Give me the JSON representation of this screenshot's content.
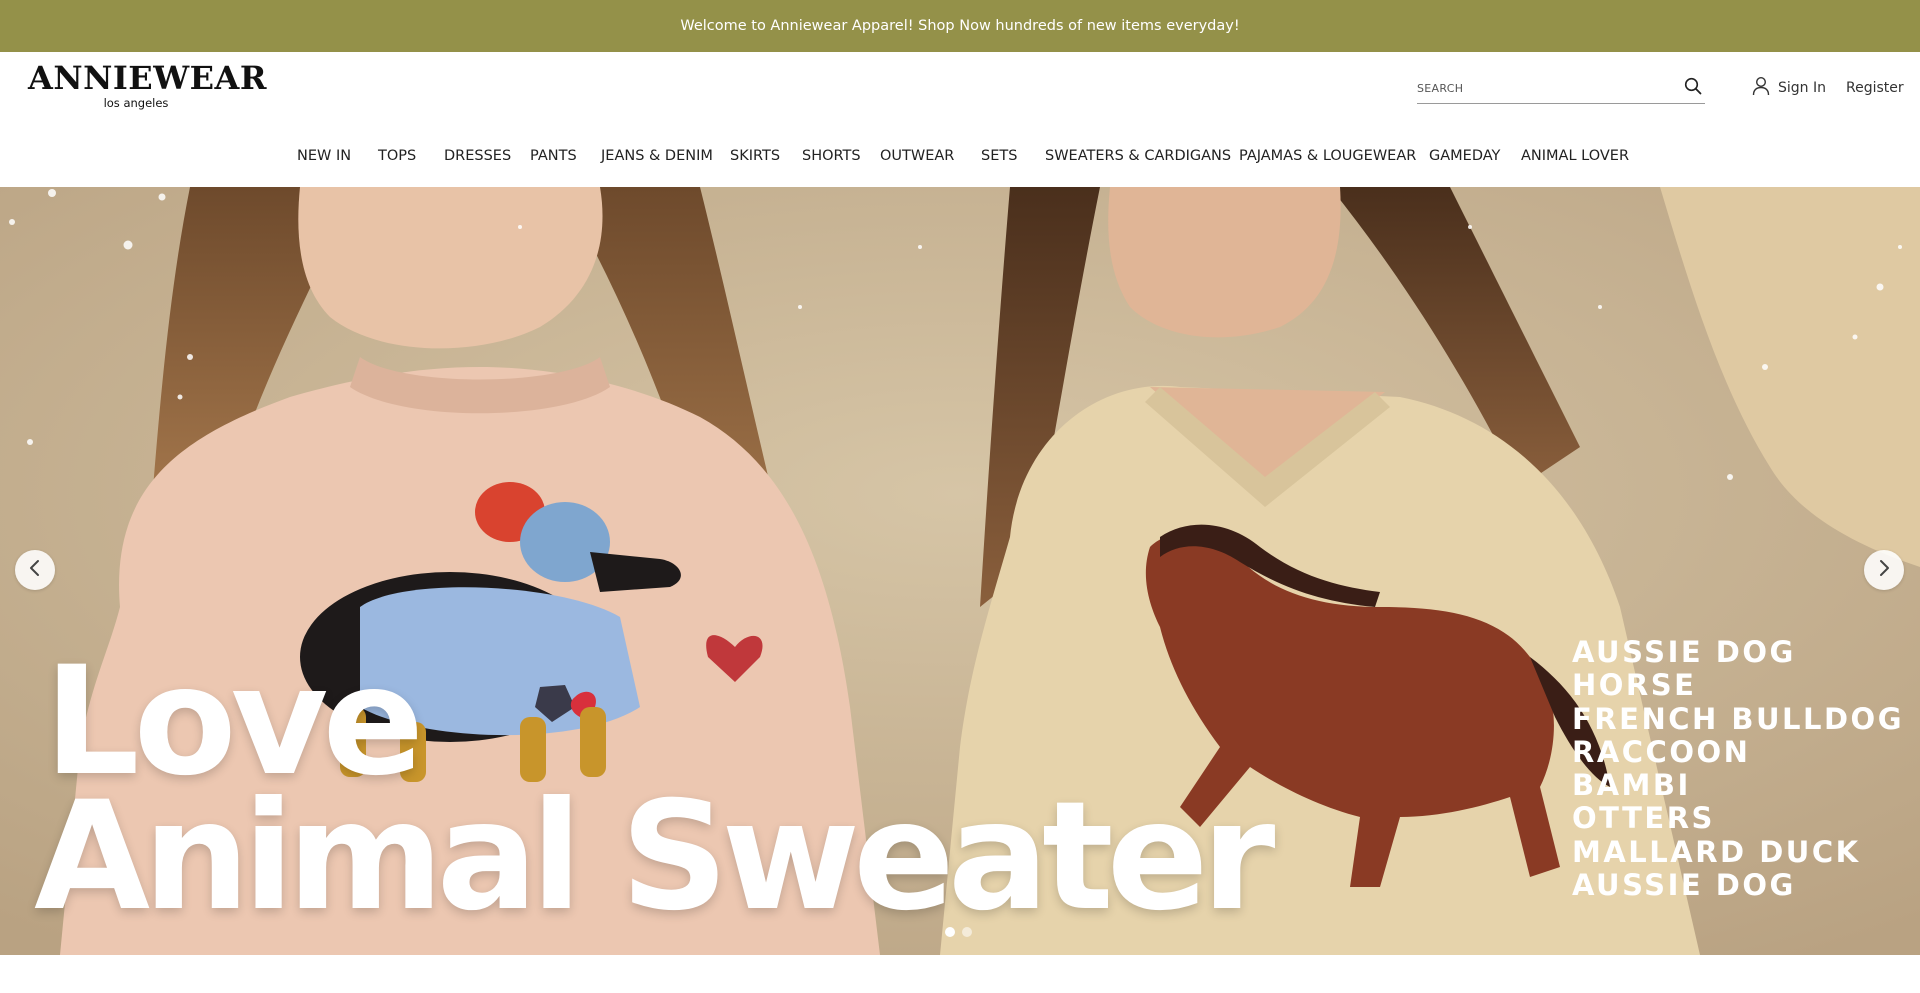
{
  "announcement": {
    "text": "Welcome to Anniewear Apparel! Shop Now hundreds of new items everyday!",
    "background_color": "#949149"
  },
  "header": {
    "logo_main": "ANNIEWEAR",
    "logo_sub": "los angeles",
    "search_placeholder": "SEARCH",
    "search_icon": "search-icon",
    "account_icon": "user-icon",
    "sign_in": "Sign In",
    "register": "Register"
  },
  "nav": {
    "items": [
      {
        "label": "NEW IN"
      },
      {
        "label": "TOPS"
      },
      {
        "label": "DRESSES"
      },
      {
        "label": "PANTS"
      },
      {
        "label": "JEANS & DENIM"
      },
      {
        "label": "SKIRTS"
      },
      {
        "label": "SHORTS"
      },
      {
        "label": "OUTWEAR"
      },
      {
        "label": "SETS"
      },
      {
        "label": "SWEATERS & CARDIGANS"
      },
      {
        "label": "PAJAMAS & LOUGEWEAR"
      },
      {
        "label": "GAMEDAY"
      },
      {
        "label": "ANIMAL LOVER"
      }
    ]
  },
  "hero": {
    "headline_line1": "Love",
    "headline_line2": "Animal Sweater",
    "animal_list": [
      "AUSSIE DOG",
      "HORSE",
      "FRENCH BULLDOG",
      "RACCOON",
      "BAMBI",
      "OTTERS",
      "MALLARD DUCK",
      "AUSSIE DOG"
    ],
    "prev_icon": "chevron-left-icon",
    "next_icon": "chevron-right-icon",
    "slide_count": 2,
    "active_slide": 1
  }
}
